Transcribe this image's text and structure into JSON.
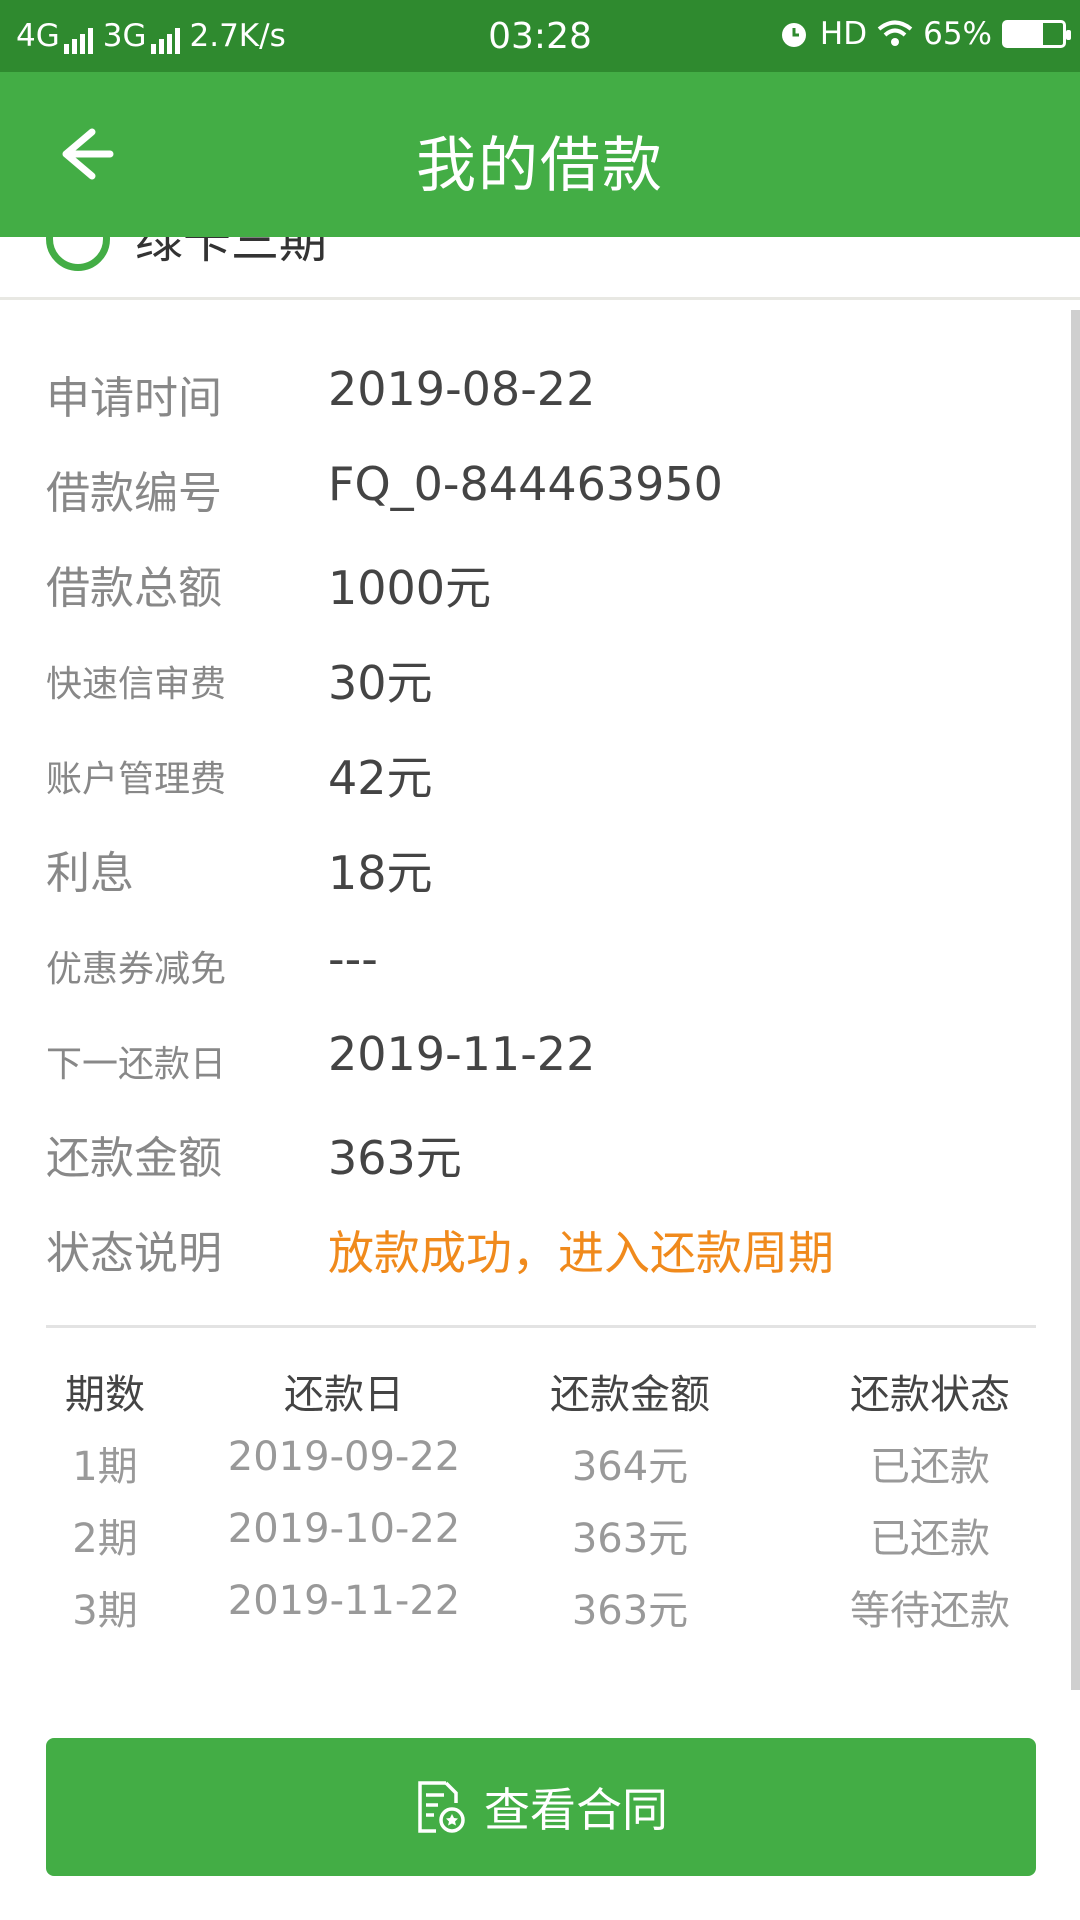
{
  "status_bar": {
    "network1": "4G",
    "network2": "3G",
    "speed": "2.7K/s",
    "time": "03:28",
    "hd": "HD",
    "battery_text": "65%",
    "battery_level": 0.65
  },
  "header": {
    "title": "我的借款",
    "back_icon": "arrow-left-icon"
  },
  "product": {
    "name": "绿卡三期"
  },
  "details": [
    {
      "label": "申请时间",
      "value": "2019-08-22"
    },
    {
      "label": "借款编号",
      "value": "FQ_0-844463950"
    },
    {
      "label": "借款总额",
      "value": "1000元"
    },
    {
      "label": "快速信审费",
      "value": "30元"
    },
    {
      "label": "账户管理费",
      "value": "42元"
    },
    {
      "label": "利息",
      "value": "18元"
    },
    {
      "label": "优惠券减免",
      "value": "---"
    },
    {
      "label": "下一还款日",
      "value": "2019-11-22"
    },
    {
      "label": "还款金额",
      "value": "363元"
    },
    {
      "label": "状态说明",
      "value": "放款成功，进入还款周期"
    }
  ],
  "schedule": {
    "headers": [
      "期数",
      "还款日",
      "还款金额",
      "还款状态"
    ],
    "rows": [
      [
        "1期",
        "2019-09-22",
        "364元",
        "已还款"
      ],
      [
        "2期",
        "2019-10-22",
        "363元",
        "已还款"
      ],
      [
        "3期",
        "2019-11-22",
        "363元",
        "等待还款"
      ]
    ]
  },
  "contract_button": {
    "label": "查看合同",
    "icon": "contract-document-icon"
  },
  "colors": {
    "brand_green": "#43ad45",
    "status_bar_green": "#2f8a2f",
    "status_orange": "#f08a1c"
  }
}
